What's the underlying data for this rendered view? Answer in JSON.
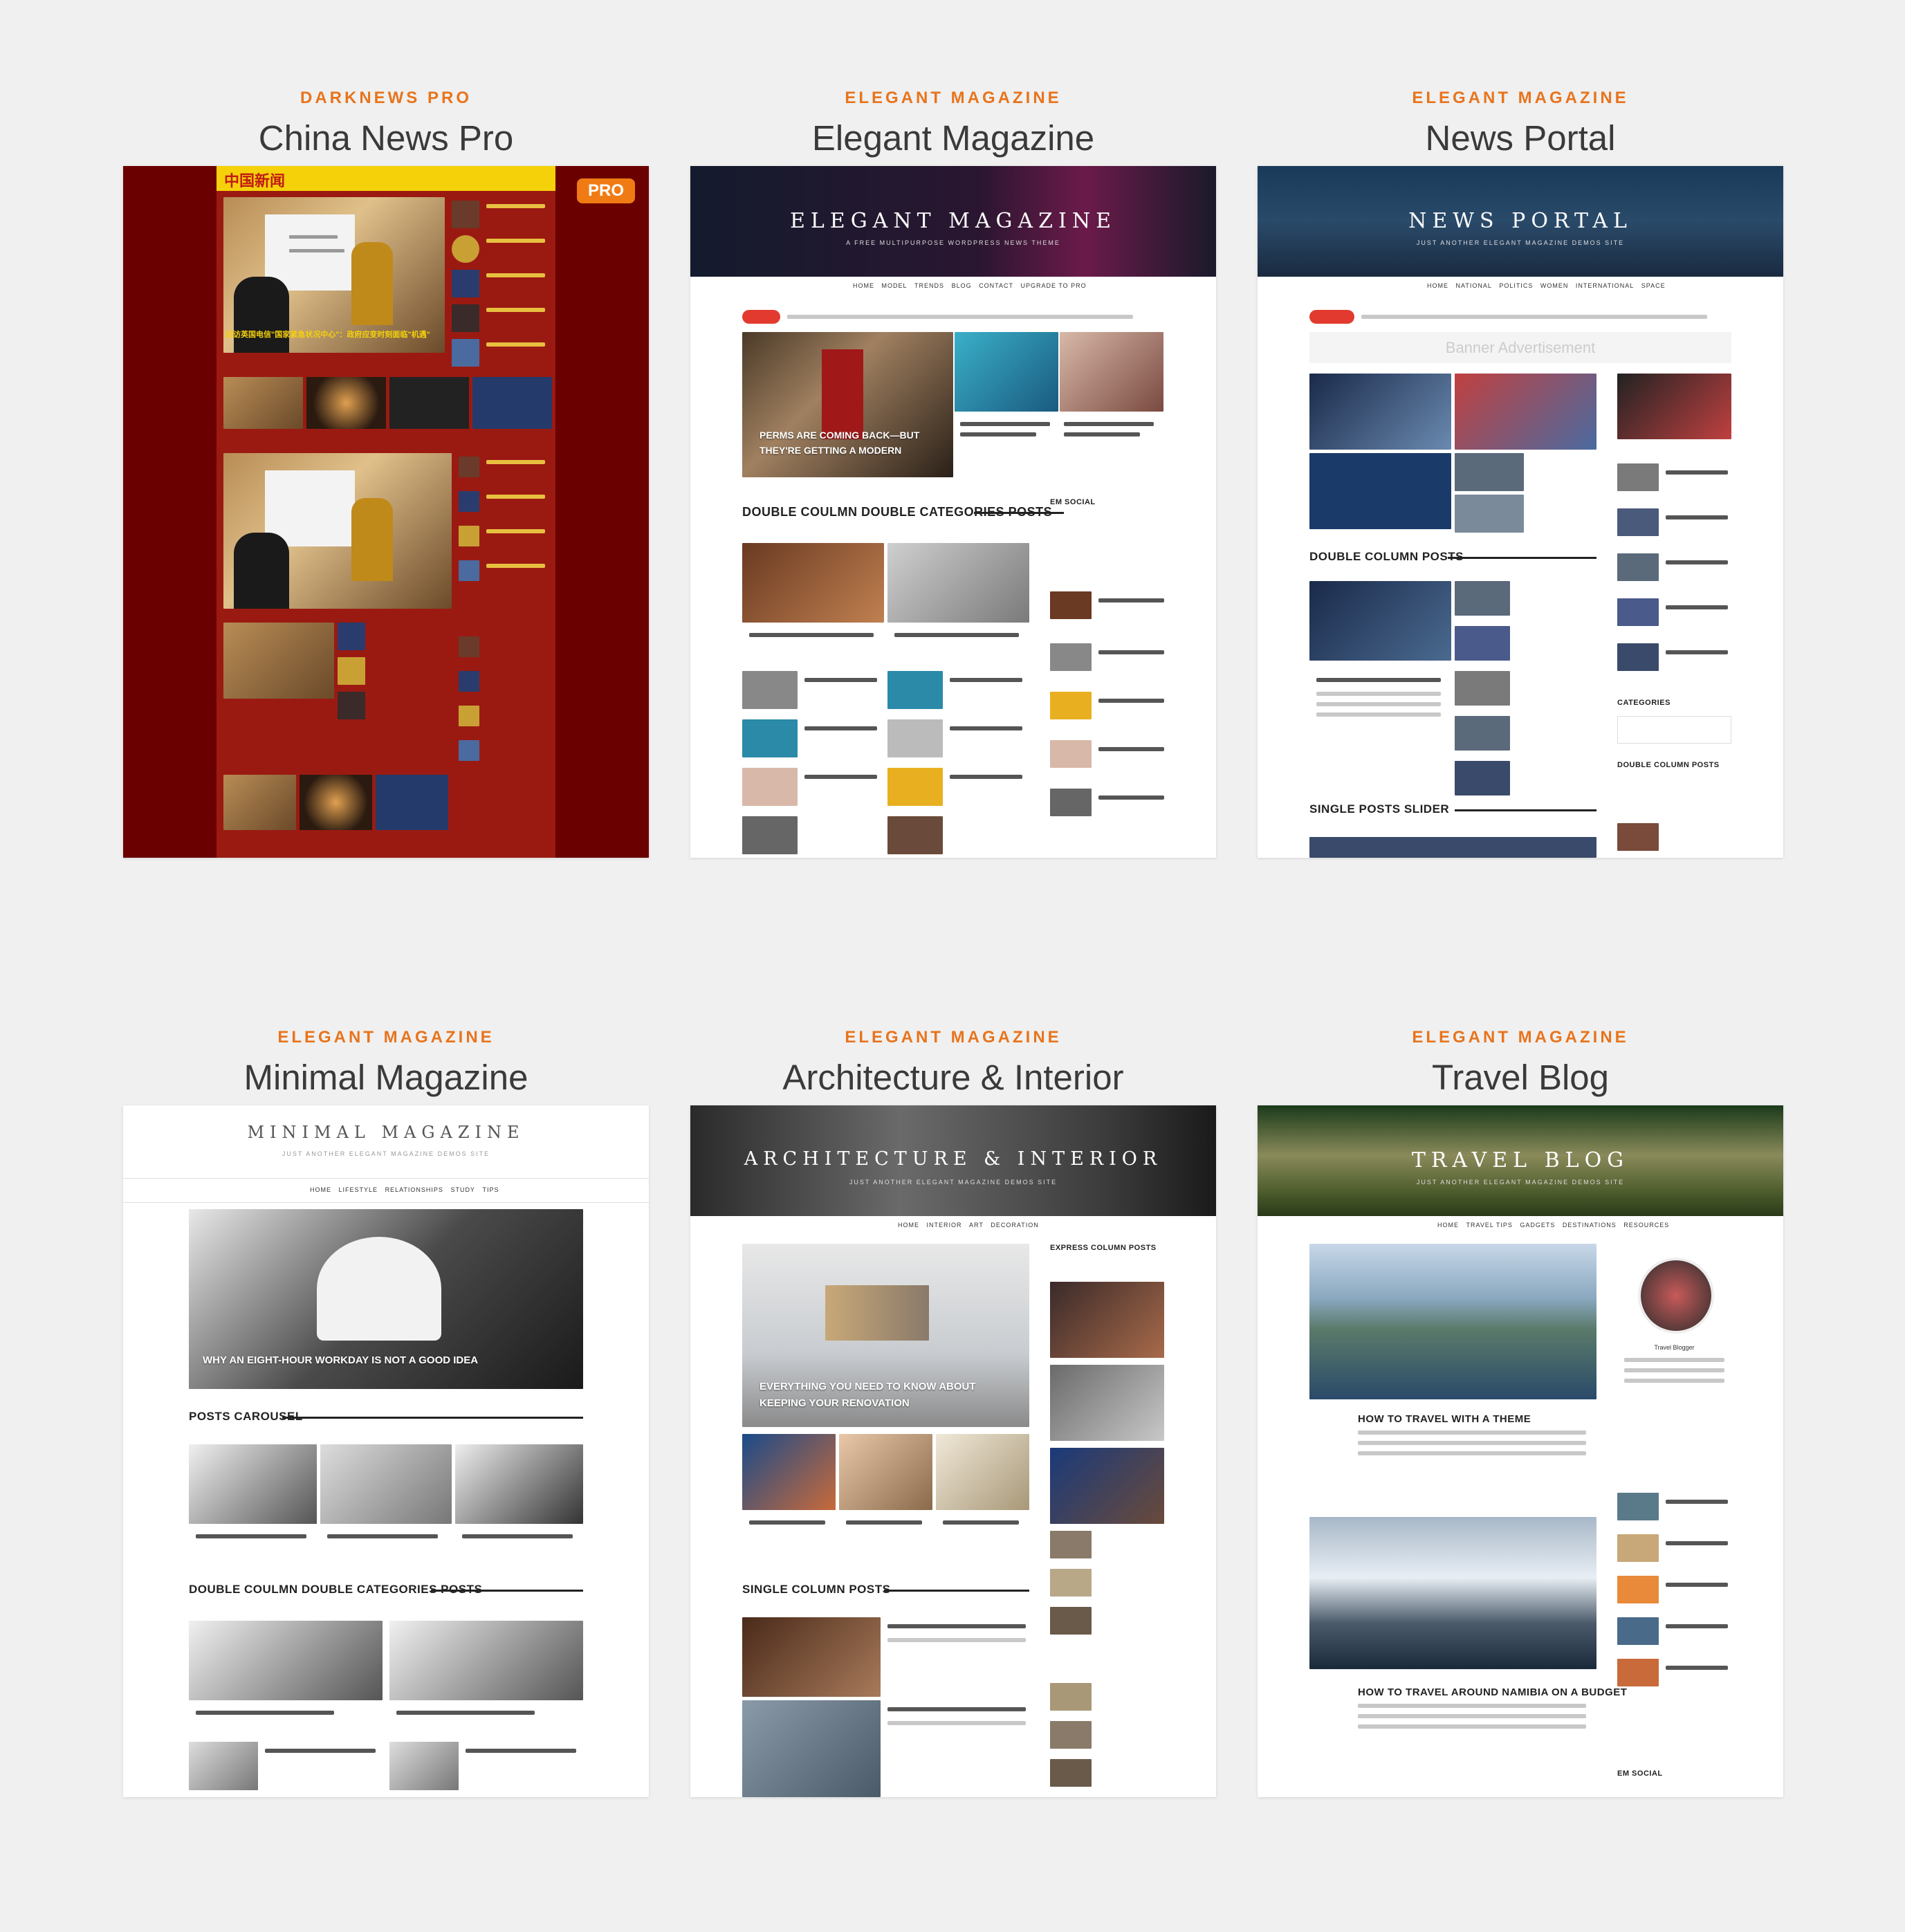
{
  "cards": [
    {
      "subtitle": "DARKNEWS PRO",
      "title": "China News Pro",
      "badge": "PRO",
      "preview": {
        "site_title": "中国新闻",
        "headline": "回访英国电信\"国家紧急状况中心\"：政府应变时刻面临\"机遇\""
      }
    },
    {
      "subtitle": "ELEGANT MAGAZINE",
      "title": "Elegant Magazine",
      "preview": {
        "site_title": "ELEGANT MAGAZINE",
        "site_tagline": "A FREE MULTIPURPOSE WORDPRESS NEWS THEME",
        "nav": [
          "HOME",
          "MODEL",
          "TRENDS",
          "BLOG",
          "CONTACT",
          "UPGRADE TO PRO"
        ],
        "hero_caption": "PERMS ARE COMING BACK—BUT THEY'RE GETTING A MODERN",
        "section_title": "DOUBLE COULMN DOUBLE CATEGORIES POSTS",
        "sidebar_title": "EM SOCIAL"
      }
    },
    {
      "subtitle": "ELEGANT MAGAZINE",
      "title": "News Portal",
      "preview": {
        "site_title": "NEWS PORTAL",
        "site_tagline": "JUST ANOTHER ELEGANT MAGAZINE DEMOS SITE",
        "nav": [
          "HOME",
          "NATIONAL",
          "POLITICS",
          "WOMEN",
          "INTERNATIONAL",
          "SPACE"
        ],
        "banner": "Banner Advertisement",
        "section_title": "DOUBLE COLUMN POSTS",
        "section_title_2": "SINGLE POSTS SLIDER",
        "sidebar_title": "CATEGORIES",
        "sidebar_title_2": "DOUBLE COLUMN POSTS"
      }
    },
    {
      "subtitle": "ELEGANT MAGAZINE",
      "title": "Minimal Magazine",
      "preview": {
        "site_title": "MINIMAL MAGAZINE",
        "site_tagline": "JUST ANOTHER ELEGANT MAGAZINE DEMOS SITE",
        "nav": [
          "HOME",
          "LIFESTYLE",
          "RELATIONSHIPS",
          "STUDY",
          "TIPS"
        ],
        "hero_caption": "WHY AN EIGHT-HOUR WORKDAY IS NOT A GOOD IDEA",
        "section_title": "POSTS CAROUSEL",
        "section_title_2": "DOUBLE COULMN DOUBLE CATEGORIES POSTS"
      }
    },
    {
      "subtitle": "ELEGANT MAGAZINE",
      "title": "Architecture & Interior",
      "preview": {
        "site_title": "ARCHITECTURE & INTERIOR",
        "site_tagline": "JUST ANOTHER ELEGANT MAGAZINE DEMOS SITE",
        "nav": [
          "HOME",
          "INTERIOR",
          "ART",
          "DECORATION"
        ],
        "hero_caption": "EVERYTHING YOU NEED TO KNOW ABOUT KEEPING YOUR RENOVATION",
        "section_title": "SINGLE COLUMN POSTS",
        "sidebar_title": "EXPRESS COLUMN POSTS"
      }
    },
    {
      "subtitle": "ELEGANT MAGAZINE",
      "title": "Travel Blog",
      "preview": {
        "site_title": "TRAVEL BLOG",
        "site_tagline": "JUST ANOTHER ELEGANT MAGAZINE DEMOS SITE",
        "nav": [
          "HOME",
          "TRAVEL TIPS",
          "GADGETS",
          "DESTINATIONS",
          "RESOURCES"
        ],
        "post_1": "HOW TO TRAVEL WITH A THEME",
        "post_2": "HOW TO TRAVEL AROUND NAMIBIA ON A BUDGET",
        "sidebar_label": "Travel Blogger",
        "sidebar_title": "EM SOCIAL"
      }
    }
  ],
  "colors": {
    "accent": "#e8741c",
    "title": "#3a3a3a",
    "background": "#f0f0f0",
    "red": "#e23a2e"
  }
}
